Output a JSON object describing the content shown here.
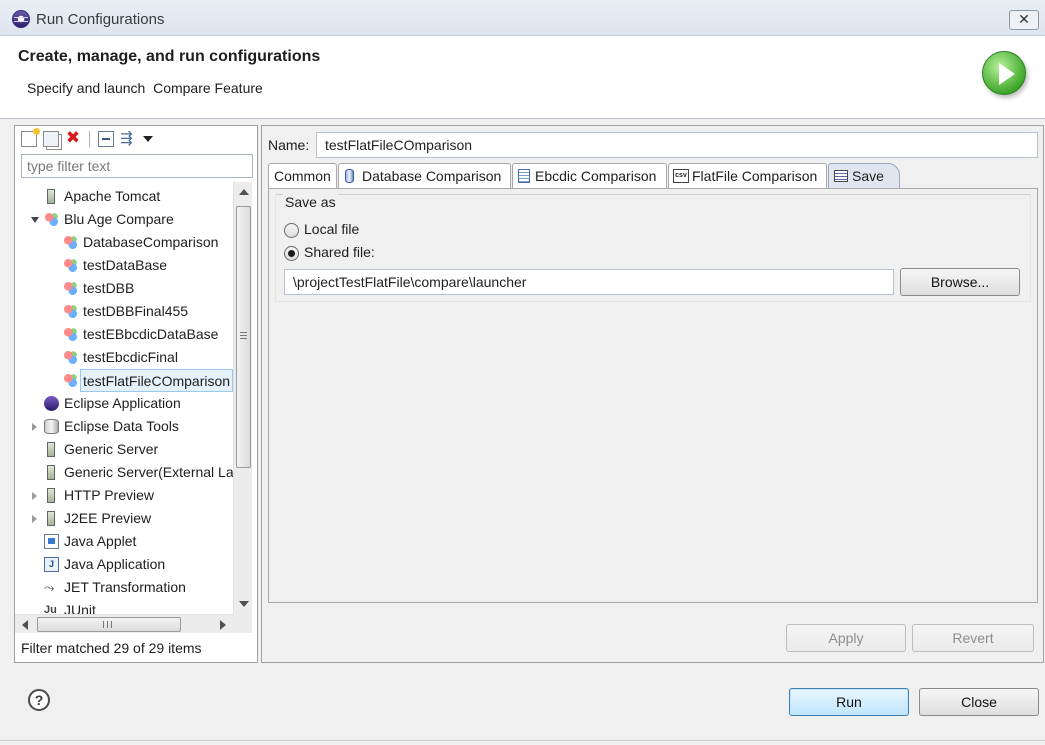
{
  "window": {
    "title": "Run Configurations",
    "close_glyph": "✕"
  },
  "header": {
    "title": "Create, manage, and run configurations",
    "subtitle": "Specify and launch  Compare Feature",
    "banner_icon": "run-icon"
  },
  "left_panel": {
    "toolbar_icons": [
      "new-configuration-icon",
      "duplicate-icon",
      "delete-icon",
      "collapse-all-icon",
      "filter-icon",
      "view-menu-dropdown-icon"
    ],
    "delete_glyph": "✖",
    "filter_glyph": "⇶",
    "filter_placeholder": "type filter text",
    "tree": [
      {
        "label": "Apache Tomcat",
        "icon": "server-icon",
        "level": 0,
        "expander": "none"
      },
      {
        "label": "Blu Age Compare",
        "icon": "compare-icon",
        "level": 0,
        "expander": "open"
      },
      {
        "label": "DatabaseComparison",
        "icon": "compare-icon",
        "level": 1,
        "expander": "none"
      },
      {
        "label": "testDataBase",
        "icon": "compare-icon",
        "level": 1,
        "expander": "none"
      },
      {
        "label": "testDBB",
        "icon": "compare-icon",
        "level": 1,
        "expander": "none"
      },
      {
        "label": "testDBBFinal455",
        "icon": "compare-icon",
        "level": 1,
        "expander": "none"
      },
      {
        "label": "testEBbcdicDataBase",
        "icon": "compare-icon",
        "level": 1,
        "expander": "none"
      },
      {
        "label": "testEbcdicFinal",
        "icon": "compare-icon",
        "level": 1,
        "expander": "none"
      },
      {
        "label": "testFlatFileCOmparison",
        "icon": "compare-icon",
        "level": 1,
        "expander": "none",
        "selected": true
      },
      {
        "label": "Eclipse Application",
        "icon": "eclipse-icon",
        "level": 0,
        "expander": "none"
      },
      {
        "label": "Eclipse Data Tools",
        "icon": "database-icon",
        "level": 0,
        "expander": "closed"
      },
      {
        "label": "Generic Server",
        "icon": "server-icon",
        "level": 0,
        "expander": "none"
      },
      {
        "label": "Generic Server(External La",
        "icon": "server-icon",
        "level": 0,
        "expander": "none"
      },
      {
        "label": "HTTP Preview",
        "icon": "server-icon",
        "level": 0,
        "expander": "closed"
      },
      {
        "label": "J2EE Preview",
        "icon": "server-icon",
        "level": 0,
        "expander": "closed"
      },
      {
        "label": "Java Applet",
        "icon": "java-applet-icon",
        "level": 0,
        "expander": "none"
      },
      {
        "label": "Java Application",
        "icon": "java-application-icon",
        "level": 0,
        "expander": "none"
      },
      {
        "label": "JET Transformation",
        "icon": "jet-icon",
        "level": 0,
        "expander": "none"
      },
      {
        "label": "JUnit",
        "icon": "junit-icon",
        "level": 0,
        "expander": "none"
      }
    ],
    "status": "Filter matched 29 of 29 items"
  },
  "right_panel": {
    "name_label": "Name:",
    "name_value": "testFlatFileCOmparison",
    "tabs": [
      {
        "label": "Common",
        "icon": ""
      },
      {
        "label": "Database Comparison",
        "icon": "database-tab-icon"
      },
      {
        "label": "Ebcdic Comparison",
        "icon": "ebcdic-tab-icon"
      },
      {
        "label": "FlatFile Comparison",
        "icon": "csv-tab-icon"
      },
      {
        "label": "Save",
        "icon": "save-tab-icon",
        "active": true
      }
    ],
    "csv_glyph": "csv",
    "save": {
      "legend": "Save as",
      "local_label": "Local file",
      "shared_label": "Shared file:",
      "selected": "shared",
      "path_value": "\\projectTestFlatFile\\compare\\launcher",
      "browse_label": "Browse..."
    },
    "apply_label": "Apply",
    "revert_label": "Revert"
  },
  "footer": {
    "help_glyph": "?",
    "run_label": "Run",
    "close_label": "Close"
  },
  "colors": {
    "selection_bg": "#e5f1fb",
    "run_accent": "#3c7fb1",
    "delete_red": "#d61c1c",
    "banner_green": "#3fa82b"
  }
}
